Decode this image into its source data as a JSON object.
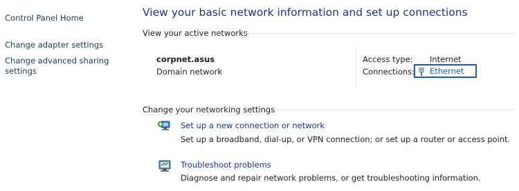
{
  "sidebar": {
    "home": "Control Panel Home",
    "adapter": "Change adapter settings",
    "advanced": "Change advanced sharing settings"
  },
  "main": {
    "title": "View your basic network information and set up connections",
    "active_networks": {
      "header": "View your active networks",
      "network_name": "corpnet.asus",
      "network_category": "Domain network",
      "access_type_label": "Access type:",
      "access_type_value": "Internet",
      "connections_label": "Connections:",
      "connection_name": "Ethernet"
    },
    "change_settings": {
      "header": "Change your networking settings",
      "tasks": [
        {
          "label": "Set up a new connection or network",
          "description": "Set up a broadband, dial-up, or VPN connection; or set up a router or access point.",
          "icon": "network-setup-icon"
        },
        {
          "label": "Troubleshoot problems",
          "description": "Diagnose and repair network problems, or get troubleshooting information.",
          "icon": "troubleshoot-icon"
        }
      ]
    }
  },
  "colors": {
    "title": "#1e3287",
    "link": "#1e3287",
    "selection_border": "#1e5aa0"
  }
}
